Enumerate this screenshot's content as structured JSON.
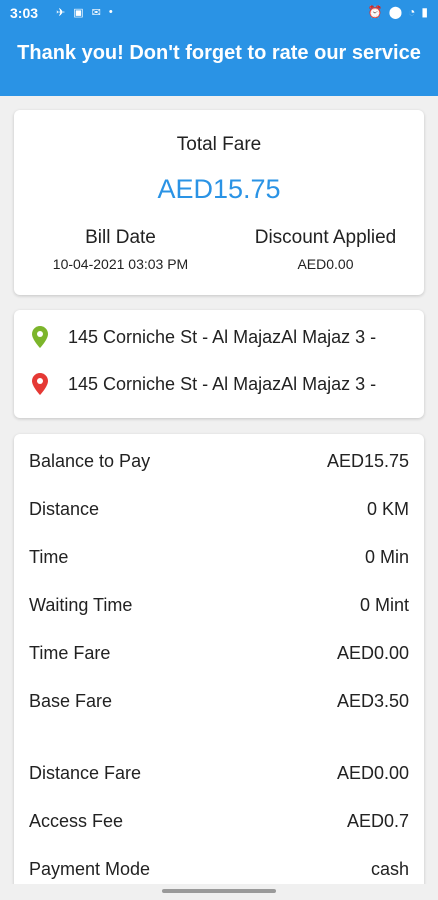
{
  "status_bar": {
    "time": "3:03",
    "left_icons": [
      "✈",
      "▣",
      "✉",
      "•"
    ],
    "right_icons": [
      "⏰",
      "⬤",
      "◔",
      "▮"
    ]
  },
  "header": {
    "title": "Thank you! Don't forget to rate our service"
  },
  "fare": {
    "total_label": "Total Fare",
    "total_value": "AED15.75",
    "bill_date_label": "Bill Date",
    "bill_date_value": "10-04-2021 03:03 PM",
    "discount_label": "Discount Applied",
    "discount_value": "AED0.00"
  },
  "locations": {
    "pickup": "145 Corniche St - Al MajazAl Majaz 3 -",
    "drop": "145 Corniche St - Al MajazAl Majaz 3 -",
    "pickup_color": "#7cb52b",
    "drop_color": "#e53935"
  },
  "details": [
    {
      "label": "Balance to Pay",
      "value": "AED15.75"
    },
    {
      "label": "Distance",
      "value": "0 KM"
    },
    {
      "label": "Time",
      "value": "0 Min"
    },
    {
      "label": "Waiting Time",
      "value": "0 Mint"
    },
    {
      "label": "Time Fare",
      "value": "AED0.00"
    },
    {
      "label": "Base Fare",
      "value": "AED3.50"
    },
    {
      "label": "Distance Fare",
      "value": "AED0.00"
    },
    {
      "label": "Access Fee",
      "value": "AED0.7"
    },
    {
      "label": "Payment Mode",
      "value": "cash"
    }
  ],
  "colors": {
    "accent": "#2a93e5"
  }
}
